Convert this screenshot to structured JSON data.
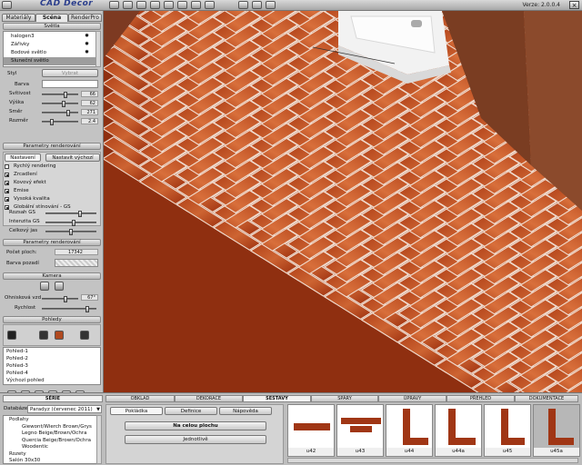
{
  "app": {
    "title": "CAD Decor",
    "version": "Verze: 2.0.0.4",
    "close_symbol": "×"
  },
  "toolbar": {
    "icons": [
      "open-icon",
      "save-icon",
      "camera-icon",
      "photo-icon",
      "print-icon",
      "help-icon",
      "settings-icon",
      "window-icon",
      "undo-icon",
      "redo-icon",
      "layers-icon"
    ]
  },
  "left_tabs": [
    "Materiály",
    "Scéna",
    "RenderPro"
  ],
  "lights": {
    "header": "Světla",
    "items": [
      "halogen3",
      "Zářivky",
      "Bodové světlo",
      "Sluneční světlo"
    ],
    "selected": 3
  },
  "light_props": {
    "style_label": "Styl",
    "choose_label": "Vybrat",
    "color_label": "Barva",
    "sliders": [
      {
        "label": "Svítivost",
        "value": "66",
        "pct": 0.66
      },
      {
        "label": "Výška",
        "value": "62",
        "pct": 0.62
      },
      {
        "label": "Směr",
        "value": "271",
        "pct": 0.75
      },
      {
        "label": "Rozměr",
        "value": "2.4",
        "pct": 0.24
      }
    ]
  },
  "render_params": {
    "header": "Parametry renderování",
    "tab_settings": "Nastavení",
    "tab_default": "Nastavit výchozí",
    "options": [
      {
        "label": "Rychlý rendering",
        "checked": false
      },
      {
        "label": "Zrcadlení",
        "checked": true
      },
      {
        "label": "Kovový efekt",
        "checked": true
      },
      {
        "label": "Emise",
        "checked": true
      },
      {
        "label": "Vysoká kvalita",
        "checked": true
      },
      {
        "label": "Globální stínování - GS",
        "checked": true
      }
    ],
    "gs_sliders": [
      {
        "label": "Rozsah GS",
        "pct": 0.7
      },
      {
        "label": "Intenzita GS",
        "pct": 0.55
      },
      {
        "label": "Celkový jas",
        "pct": 0.5
      }
    ]
  },
  "render_params2": {
    "header": "Parametry renderování",
    "tiles_label": "Počet ploch:",
    "tiles_value": "17342",
    "bg_label": "Barva pozadí"
  },
  "camera": {
    "header": "Kamera",
    "fov_label": "Ohnisková vzd",
    "fov_value": "67°",
    "fov_pct": 0.67,
    "speed_label": "Rychlost",
    "speed_pct": 0.85
  },
  "views": {
    "header": "Pohledy",
    "items": [
      "Pohled-1",
      "Pohled-2",
      "Pohled-3",
      "Pohled-4",
      "Výchozí pohled"
    ]
  },
  "bottom_left": {
    "series_tab": "SÉRIE",
    "db_label": "Databáze",
    "db_value": "Paradyz (červenec 2011)",
    "tree": [
      "Podlahy",
      "Giewont/Wierch Brown/Grys",
      "Legno Beige/Brown/Ochra",
      "Quercia Beige/Brown/Ochra",
      "Woodentic",
      "Rozety",
      "Salón 30x30"
    ]
  },
  "bottom_tabs": [
    "OBKLAD",
    "DEKORACE",
    "SESTAVY",
    "SPÁRY",
    "ÚPRAVY",
    "PŘEHLED",
    "DOKUMENTACE"
  ],
  "bottom_active_tab": 2,
  "subtabs": [
    "Pokládka",
    "Definice",
    "Nápověda"
  ],
  "actions": {
    "whole_surface": "Na celou plochu",
    "single": "Jednotlivě"
  },
  "patterns": [
    {
      "id": "u42"
    },
    {
      "id": "u43"
    },
    {
      "id": "u44"
    },
    {
      "id": "u44a"
    },
    {
      "id": "u45"
    },
    {
      "id": "u45a"
    }
  ],
  "selected_pattern": 5,
  "colors": {
    "tile_dark": "#a03615",
    "tile_light": "#c65a2a",
    "grout": "#f1ddd0",
    "wall": "#8a4a2e"
  }
}
